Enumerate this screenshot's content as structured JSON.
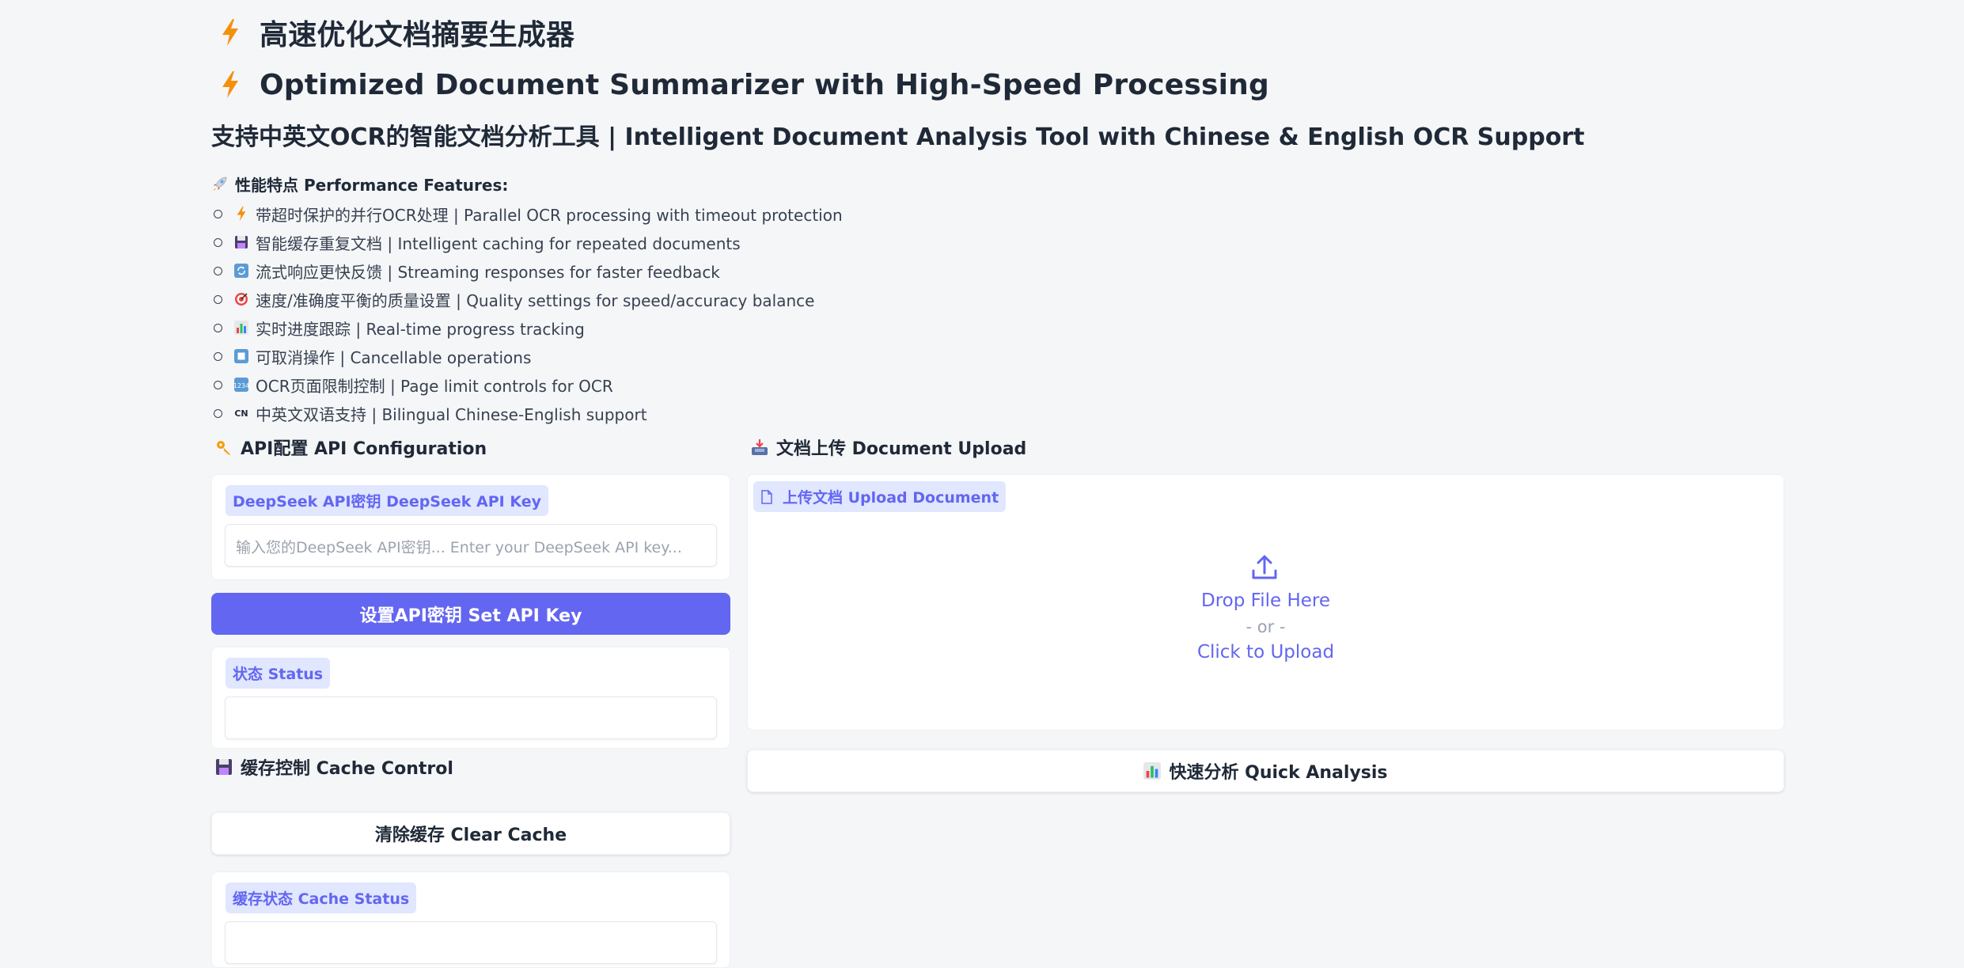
{
  "header": {
    "title_cn": "高速优化文档摘要生成器",
    "title_en": "Optimized Document Summarizer with High-Speed Processing",
    "subtitle": "支持中英文OCR的智能文档分析工具 | Intelligent Document Analysis Tool with Chinese & English OCR Support"
  },
  "features": {
    "title": "性能特点 Performance Features:",
    "items": [
      {
        "icon": "lightning-icon",
        "label": "带超时保护的并行OCR处理 | Parallel OCR processing with timeout protection"
      },
      {
        "icon": "floppy-disk-icon",
        "label": "智能缓存重复文档 | Intelligent caching for repeated documents"
      },
      {
        "icon": "refresh-icon",
        "label": "流式响应更快反馈 | Streaming responses for faster feedback"
      },
      {
        "icon": "target-icon",
        "label": "速度/准确度平衡的质量设置 | Quality settings for speed/accuracy balance"
      },
      {
        "icon": "bar-chart-icon",
        "label": "实时进度跟踪 | Real-time progress tracking"
      },
      {
        "icon": "stop-button-icon",
        "label": "可取消操作 | Cancellable operations"
      },
      {
        "icon": "numbers-icon",
        "label": "OCR页面限制控制 | Page limit controls for OCR"
      },
      {
        "icon": "cn-icon",
        "label": "中英文双语支持 | Bilingual Chinese-English support"
      }
    ]
  },
  "api": {
    "section_title": "API配置 API Configuration",
    "key_label": "DeepSeek API密钥 DeepSeek API Key",
    "key_placeholder": "输入您的DeepSeek API密钥... Enter your DeepSeek API key...",
    "set_button": "设置API密钥 Set API Key",
    "status_label": "状态 Status",
    "status_value": ""
  },
  "cache": {
    "section_title": "缓存控制 Cache Control",
    "clear_button": "清除缓存 Clear Cache",
    "status_label": "缓存状态 Cache Status",
    "status_value": ""
  },
  "upload": {
    "section_title": "文档上传 Document Upload",
    "label": "上传文档 Upload Document",
    "drop_text": "Drop File Here",
    "or_text": "- or -",
    "click_text": "Click to Upload",
    "analyze_button": "快速分析 Quick Analysis"
  },
  "colors": {
    "accent": "#6366f1",
    "badge_bg": "#e0e7ff",
    "page_bg": "#f5f6f8"
  }
}
